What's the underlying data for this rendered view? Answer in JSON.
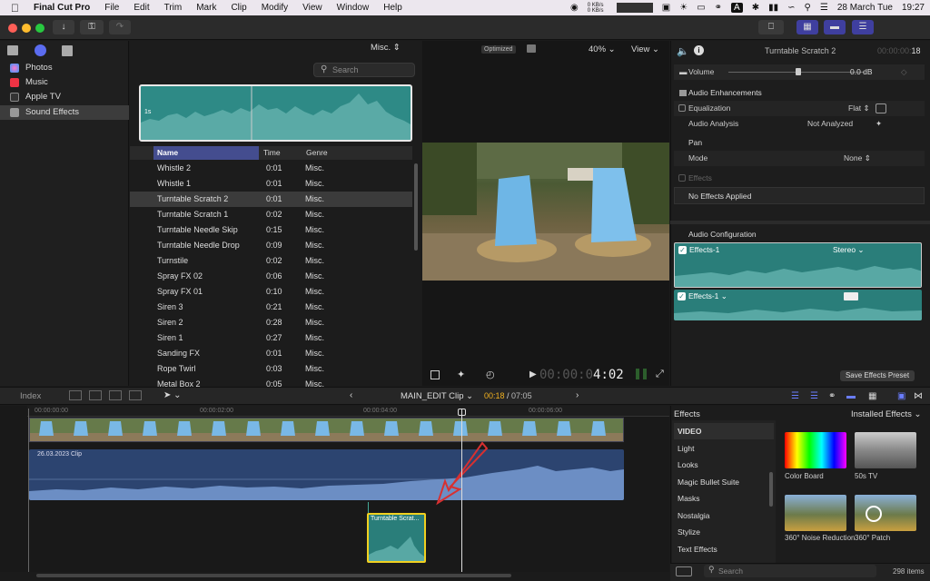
{
  "menubar": {
    "app": "Final Cut Pro",
    "items": [
      "File",
      "Edit",
      "Trim",
      "Mark",
      "Clip",
      "Modify",
      "View",
      "Window",
      "Help"
    ],
    "net": "0 KB/s\n0 KB/s",
    "date": "28 March Tue",
    "time": "19:27"
  },
  "browser": {
    "filter": "Misc.",
    "search_placeholder": "Search",
    "waveform_label": "1s",
    "sidebar": [
      "Photos",
      "Music",
      "Apple TV",
      "Sound Effects"
    ],
    "columns": [
      "Name",
      "Time",
      "Genre"
    ],
    "rows": [
      {
        "name": "Whistle 2",
        "time": "0:01",
        "genre": "Misc."
      },
      {
        "name": "Whistle 1",
        "time": "0:01",
        "genre": "Misc."
      },
      {
        "name": "Turntable Scratch 2",
        "time": "0:01",
        "genre": "Misc."
      },
      {
        "name": "Turntable Scratch 1",
        "time": "0:02",
        "genre": "Misc."
      },
      {
        "name": "Turntable Needle Skip",
        "time": "0:15",
        "genre": "Misc."
      },
      {
        "name": "Turntable Needle Drop",
        "time": "0:09",
        "genre": "Misc."
      },
      {
        "name": "Turnstile",
        "time": "0:02",
        "genre": "Misc."
      },
      {
        "name": "Spray FX 02",
        "time": "0:06",
        "genre": "Misc."
      },
      {
        "name": "Spray FX 01",
        "time": "0:10",
        "genre": "Misc."
      },
      {
        "name": "Siren 3",
        "time": "0:21",
        "genre": "Misc."
      },
      {
        "name": "Siren 2",
        "time": "0:28",
        "genre": "Misc."
      },
      {
        "name": "Siren 1",
        "time": "0:27",
        "genre": "Misc."
      },
      {
        "name": "Sanding FX",
        "time": "0:01",
        "genre": "Misc."
      },
      {
        "name": "Rope Twirl",
        "time": "0:03",
        "genre": "Misc."
      },
      {
        "name": "Metal Box 2",
        "time": "0:05",
        "genre": "Misc."
      }
    ]
  },
  "viewer": {
    "optimized": "Optimized",
    "zoom": "40%",
    "view": "View",
    "timecode_dim": "00:00:0",
    "timecode": "4:02"
  },
  "inspector": {
    "title": "Turntable Scratch 2",
    "duration_dim": "00:00:00:",
    "duration": "18",
    "volume_label": "Volume",
    "volume_value": "0.0 dB",
    "enhancements": "Audio Enhancements",
    "equalization": "Equalization",
    "eq_value": "Flat",
    "analysis": "Audio Analysis",
    "analysis_value": "Not Analyzed",
    "pan": "Pan",
    "mode": "Mode",
    "mode_value": "None",
    "effects": "Effects",
    "no_effects": "No Effects Applied",
    "audio_config": "Audio Configuration",
    "config1": "Effects-1",
    "stereo": "Stereo",
    "config2": "Effects-1",
    "save_preset": "Save Effects Preset"
  },
  "timeline": {
    "index": "Index",
    "project": "MAIN_EDIT Clip",
    "time_now": "00:18",
    "time_total": "07:05",
    "ruler": [
      "00:00:00:00",
      "00:00:02:00",
      "00:00:04:00",
      "00:00:06:00"
    ],
    "clip_label": "26.03.2023 Clip",
    "sfx_clip": "Turntable Scrat..."
  },
  "effects": {
    "title": "Effects",
    "installed": "Installed Effects",
    "categories": [
      "VIDEO",
      "Light",
      "Looks",
      "Magic Bullet Suite",
      "Masks",
      "Nostalgia",
      "Stylize",
      "Text Effects"
    ],
    "thumbs": [
      {
        "label": "Color Board"
      },
      {
        "label": "50s TV"
      },
      {
        "label": "360° Noise Reduction"
      },
      {
        "label": "360° Patch"
      }
    ],
    "search_placeholder": "Search",
    "count": "298 items"
  }
}
